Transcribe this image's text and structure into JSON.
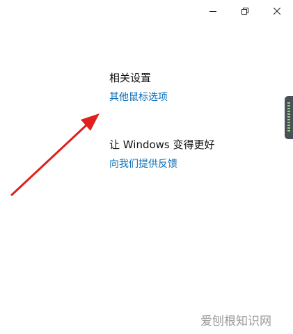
{
  "window": {
    "controls": {
      "minimize_icon": "minimize-icon",
      "restore_icon": "restore-icon",
      "close_icon": "close-icon"
    }
  },
  "sections": {
    "related": {
      "title": "相关设置",
      "link": "其他鼠标选项"
    },
    "feedback": {
      "title": "让 Windows 变得更好",
      "link": "向我们提供反馈"
    }
  },
  "watermark": "爱刨根知识网",
  "colors": {
    "link": "#0a6fb8",
    "arrow": "#e0201c",
    "widget": "#4a5056",
    "widget_ticks": "#8fd08a"
  }
}
